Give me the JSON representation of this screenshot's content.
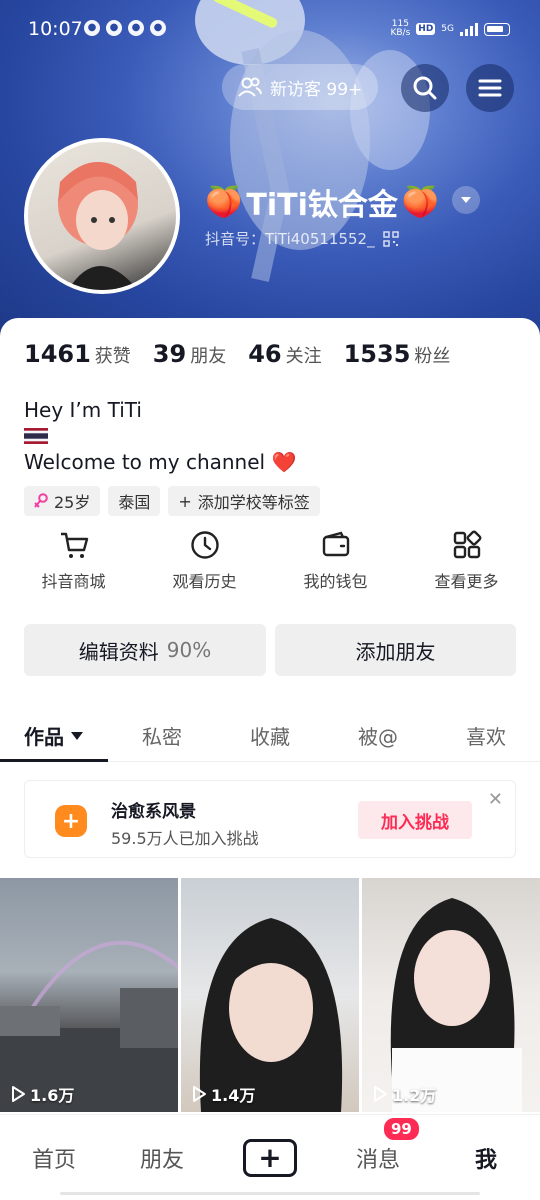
{
  "status_bar": {
    "time": "10:07",
    "net_speed_value": "115",
    "net_speed_unit": "KB/s",
    "hd": "HD",
    "network": "5G"
  },
  "header": {
    "visitor_label": "新访客 99+",
    "nickname": "TiTi钛合金",
    "nickname_emoji": "🍑",
    "douyin_id": "抖音号：TiTi40511552_"
  },
  "stats": [
    {
      "value": "1461",
      "label": "获赞"
    },
    {
      "value": "39",
      "label": "朋友"
    },
    {
      "value": "46",
      "label": "关注"
    },
    {
      "value": "1535",
      "label": "粉丝"
    }
  ],
  "bio": {
    "line1": "Hey I’m TiTi",
    "line2": "Welcome to my channel ❤️"
  },
  "tags": {
    "age": "25岁",
    "country": "泰国",
    "add_school": "添加学校等标签"
  },
  "tools": [
    {
      "label": "抖音商城",
      "icon": "cart-icon"
    },
    {
      "label": "观看历史",
      "icon": "clock-icon"
    },
    {
      "label": "我的钱包",
      "icon": "wallet-icon"
    },
    {
      "label": "查看更多",
      "icon": "grid-icon"
    }
  ],
  "actions": {
    "edit_label": "编辑资料",
    "edit_pct": "90%",
    "add_friend": "添加朋友"
  },
  "tabs": [
    "作品",
    "私密",
    "收藏",
    "被@",
    "喜欢"
  ],
  "challenge": {
    "title": "治愈系风景",
    "subtitle": "59.5万人已加入挑战",
    "join": "加入挑战"
  },
  "videos": [
    {
      "views": "1.6万"
    },
    {
      "views": "1.4万"
    },
    {
      "views": "1.2万"
    }
  ],
  "bottom_nav": {
    "home": "首页",
    "friends": "朋友",
    "messages": "消息",
    "badge": "99",
    "me": "我"
  },
  "colors": {
    "accent": "#fe2c55",
    "banner": "#2a4aa4",
    "challenge_icon": "#ff8a1e"
  }
}
